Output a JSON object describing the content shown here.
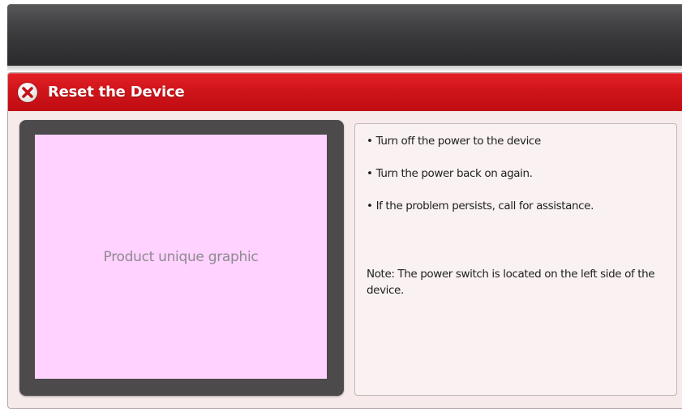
{
  "dialog": {
    "title": "Reset the Device",
    "close_icon": "close-x-icon",
    "graphic_placeholder": "Product unique graphic",
    "instructions": [
      "Turn off the power to the device",
      "Turn the power back on again.",
      "If the problem persists, call for assistance."
    ],
    "bullet": "•",
    "note": "Note: The power switch is located on the left side of the device."
  },
  "colors": {
    "header_red": "#d0151a",
    "graphic_pink": "#ffd2ff",
    "frame_dark": "#4d4a4b",
    "top_bar": "#363638"
  }
}
